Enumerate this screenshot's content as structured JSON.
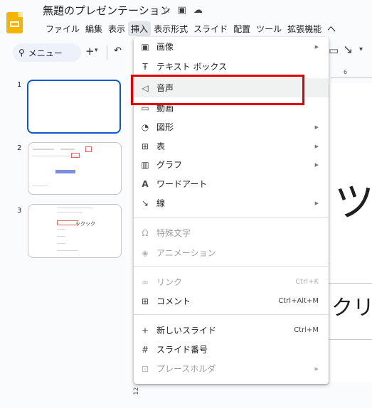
{
  "header": {
    "doc_title": "無題のプレゼンテーション",
    "title_icons": [
      "star-icon",
      "folder-icon",
      "cloud-icon"
    ],
    "menus": [
      "ファイル",
      "編集",
      "表示",
      "挿入",
      "表示形式",
      "スライド",
      "配置",
      "ツール",
      "拡張機能",
      "ヘ"
    ]
  },
  "toolbar": {
    "search_label": "メニュー",
    "plus": "+",
    "caret": "▾",
    "undo": "↶"
  },
  "filmstrip": {
    "slides": [
      {
        "number": "1"
      },
      {
        "number": "2"
      },
      {
        "number": "3",
        "text": "ックック"
      }
    ]
  },
  "canvas": {
    "ruler_tick": "6",
    "big_text": "ツ",
    "mid_text": "クリ",
    "vruler": "12"
  },
  "insert_menu": {
    "items": [
      {
        "label": "画像",
        "icon": "image-icon",
        "submenu": true,
        "disabled": false
      },
      {
        "label": "テキスト ボックス",
        "icon": "text-box-icon",
        "submenu": false,
        "disabled": false
      },
      {
        "label": "音声",
        "icon": "audio-icon",
        "submenu": false,
        "disabled": false
      },
      {
        "label": "動画",
        "icon": "video-icon",
        "submenu": false,
        "disabled": false
      },
      {
        "label": "図形",
        "icon": "shape-icon",
        "submenu": true,
        "disabled": false
      },
      {
        "label": "表",
        "icon": "table-icon",
        "submenu": true,
        "disabled": false
      },
      {
        "label": "グラフ",
        "icon": "chart-icon",
        "submenu": true,
        "disabled": false
      },
      {
        "label": "ワードアート",
        "icon": "wordart-icon",
        "submenu": false,
        "disabled": false
      },
      {
        "label": "線",
        "icon": "line-icon",
        "submenu": true,
        "disabled": false
      },
      {
        "label": "特殊文字",
        "icon": "omega-icon",
        "submenu": false,
        "disabled": true
      },
      {
        "label": "アニメーション",
        "icon": "animation-icon",
        "submenu": false,
        "disabled": true
      },
      {
        "label": "リンク",
        "icon": "link-icon",
        "shortcut": "Ctrl+K",
        "submenu": false,
        "disabled": true
      },
      {
        "label": "コメント",
        "icon": "comment-icon",
        "shortcut": "Ctrl+Alt+M",
        "submenu": false,
        "disabled": false
      },
      {
        "label": "新しいスライド",
        "icon": "plus-icon",
        "shortcut": "Ctrl+M",
        "submenu": false,
        "disabled": false
      },
      {
        "label": "スライド番号",
        "icon": "hash-icon",
        "submenu": false,
        "disabled": false
      },
      {
        "label": "プレースホルダ",
        "icon": "placeholder-icon",
        "submenu": true,
        "disabled": true
      }
    ]
  },
  "colors": {
    "highlight": "#e00000",
    "selected_slide_border": "#0b57d0",
    "logo": "#f4b400"
  }
}
